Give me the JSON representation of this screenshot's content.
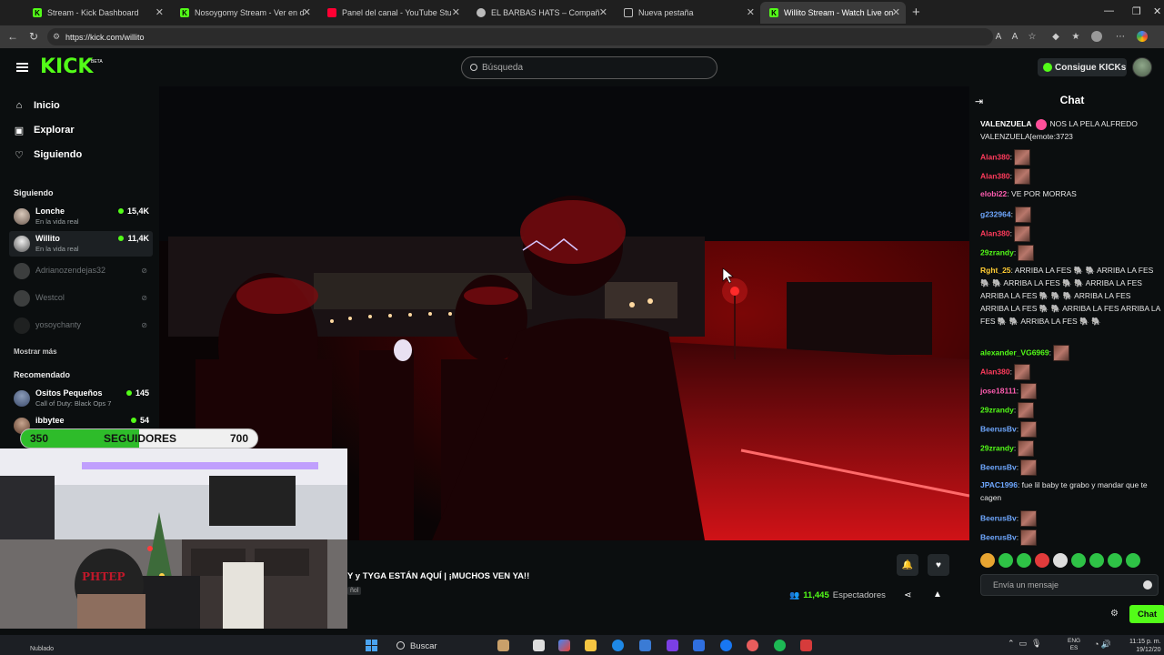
{
  "browser": {
    "tabs": [
      {
        "title": "Stream - Kick Dashboard",
        "favicon": "kick-icon",
        "color": "#53fc18"
      },
      {
        "title": "Nosoygomy Stream - Ver en directo",
        "favicon": "kick-icon",
        "color": "#53fc18"
      },
      {
        "title": "Panel del canal - YouTube Studio",
        "favicon": "youtube-studio-icon",
        "color": "#ff0033"
      },
      {
        "title": "EL BARBAS HATS – Compañía de s",
        "favicon": "shop-icon",
        "color": "#bbbbbb"
      },
      {
        "title": "Nueva pestaña",
        "favicon": "new-tab-icon",
        "color": "#bbbbbb"
      },
      {
        "title": "Willito Stream - Watch Live on",
        "favicon": "kick-icon",
        "color": "#53fc18"
      }
    ],
    "url": "https://kick.com/willito"
  },
  "header": {
    "logo": "KICK",
    "logo_badge": "BETA",
    "search_placeholder": "Búsqueda",
    "get_kicks": "Consigue KICKs"
  },
  "sidebar": {
    "nav": [
      {
        "label": "Inicio",
        "icon": "home-icon"
      },
      {
        "label": "Explorar",
        "icon": "compass-icon"
      },
      {
        "label": "Siguiendo",
        "icon": "heart-icon"
      }
    ],
    "following_title": "Siguiendo",
    "following": [
      {
        "name": "Lonche",
        "category": "En la vida real",
        "viewers": "15,4K",
        "live": true
      },
      {
        "name": "Willito",
        "category": "En la vida real",
        "viewers": "11,4K",
        "live": true
      },
      {
        "name": "Adrianozendejas32",
        "live": false
      },
      {
        "name": "Westcol",
        "live": false
      },
      {
        "name": "yosoychanty",
        "live": false
      }
    ],
    "show_more": "Mostrar más",
    "recommended_title": "Recomendado",
    "recommended": [
      {
        "name": "Ositos Pequeños",
        "category": "Call of Duty: Black Ops 7",
        "viewers": "145"
      },
      {
        "name": "ibbytee",
        "viewers": "54"
      }
    ]
  },
  "overlay": {
    "follow_current": "350",
    "follow_label": "SEGUIDORES",
    "follow_goal": "700",
    "follow_progress": 0.5
  },
  "stream": {
    "title": "Y y TYGA ESTÁN AQUÍ | ¡MUCHOS VEN YA!!",
    "language_tag": "ñol",
    "viewers_count": "11,445",
    "viewers_label": "Espectadores"
  },
  "chat": {
    "title": "Chat",
    "messages": [
      {
        "user": "VALENZUELA",
        "color": "#ffffff",
        "text": "NOS LA PELA ALFREDO VALENZUELA[emote:3723",
        "pink_emote": true
      },
      {
        "user": "Alan380",
        "color": "#ff3b5c",
        "text": ":",
        "emote": true
      },
      {
        "user": "Alan380",
        "color": "#ff3b5c",
        "text": ":",
        "emote": true
      },
      {
        "user": "elobi22",
        "color": "#ff5db1",
        "text": ": VE POR MORRAS"
      },
      {
        "user": "g232964",
        "color": "#6fa8ff",
        "text": ":",
        "emote": true
      },
      {
        "user": "Alan380",
        "color": "#ff3b5c",
        "text": ":",
        "emote": true
      },
      {
        "user": "29zrandy",
        "color": "#53fc18",
        "text": ":",
        "emote": true
      },
      {
        "user": "Rght_25",
        "color": "#ffcc33",
        "text": ": ARRIBA LA FES 🐘 🐘 ARRIBA LA FES 🐘 🐘 ARRIBA LA FES 🐘 🐘 ARRIBA LA FES ARRIBA LA FES 🐘 🐘 🐘 ARRIBA LA FES ARRIBA LA FES 🐘 🐘 ARRIBA LA FES ARRIBA LA FES 🐘 🐘 ARRIBA LA FES 🐘 🐘"
      },
      {
        "user": "alexander_VG6969",
        "color": "#53fc18",
        "text": ":",
        "emote": true
      },
      {
        "user": "Alan380",
        "color": "#ff3b5c",
        "text": ":",
        "emote": true
      },
      {
        "user": "jose18111",
        "color": "#ff5db1",
        "text": ":",
        "emote": true
      },
      {
        "user": "29zrandy",
        "color": "#53fc18",
        "text": ":",
        "emote": true
      },
      {
        "user": "BeerusBv",
        "color": "#6fa8ff",
        "text": ":",
        "emote": true
      },
      {
        "user": "29zrandy",
        "color": "#53fc18",
        "text": ":",
        "emote": true
      },
      {
        "user": "BeerusBv",
        "color": "#6fa8ff",
        "text": ":",
        "emote": true
      },
      {
        "user": "JPAC1996",
        "color": "#6fa8ff",
        "text": ": fue lil baby te grabo y mandar que te cagen"
      },
      {
        "user": "BeerusBv",
        "color": "#6fa8ff",
        "text": ":",
        "emote": true
      },
      {
        "user": "BeerusBv",
        "color": "#6fa8ff",
        "text": ":",
        "emote": true
      }
    ],
    "input_placeholder": "Envía un mensaje",
    "send_label": "Chat"
  },
  "taskbar": {
    "search_label": "Buscar",
    "weather_line2": "Nublado",
    "lang_line1": "ENG",
    "lang_line2": "ES",
    "time": "11:15 p. m.",
    "date": "19/12/20"
  },
  "colors": {
    "brand": "#53fc18",
    "background": "#0b0e0f",
    "surface": "#24292c"
  }
}
